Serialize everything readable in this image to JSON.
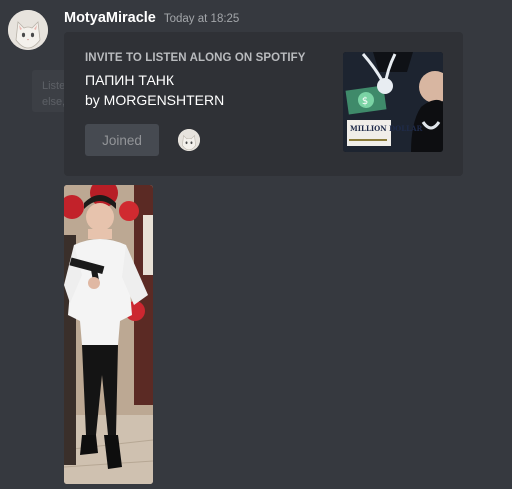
{
  "message": {
    "username": "MotyaMiracle",
    "timestamp": "Today at 18:25",
    "avatar_icon": "cat-avatar-icon",
    "ghost_tooltip_text": "Listen along with ...\nelse, no..."
  },
  "invite": {
    "label": "INVITE TO LISTEN ALONG ON SPOTIFY",
    "track_title": "ПАПИН ТАНК",
    "track_artist": "by MORGENSHTERN",
    "join_button": "Joined",
    "album_art_text": "MILLION DOLLAR",
    "listener_avatar_icon": "cat-avatar-icon"
  },
  "attachment": {
    "type": "photo",
    "subject": "person in white shirt holding a toy gun"
  },
  "colors": {
    "background": "#36393f",
    "embed_background": "#2f3136",
    "username": "#ffffff",
    "timestamp": "#a3a6aa",
    "button": "#4f545c"
  }
}
